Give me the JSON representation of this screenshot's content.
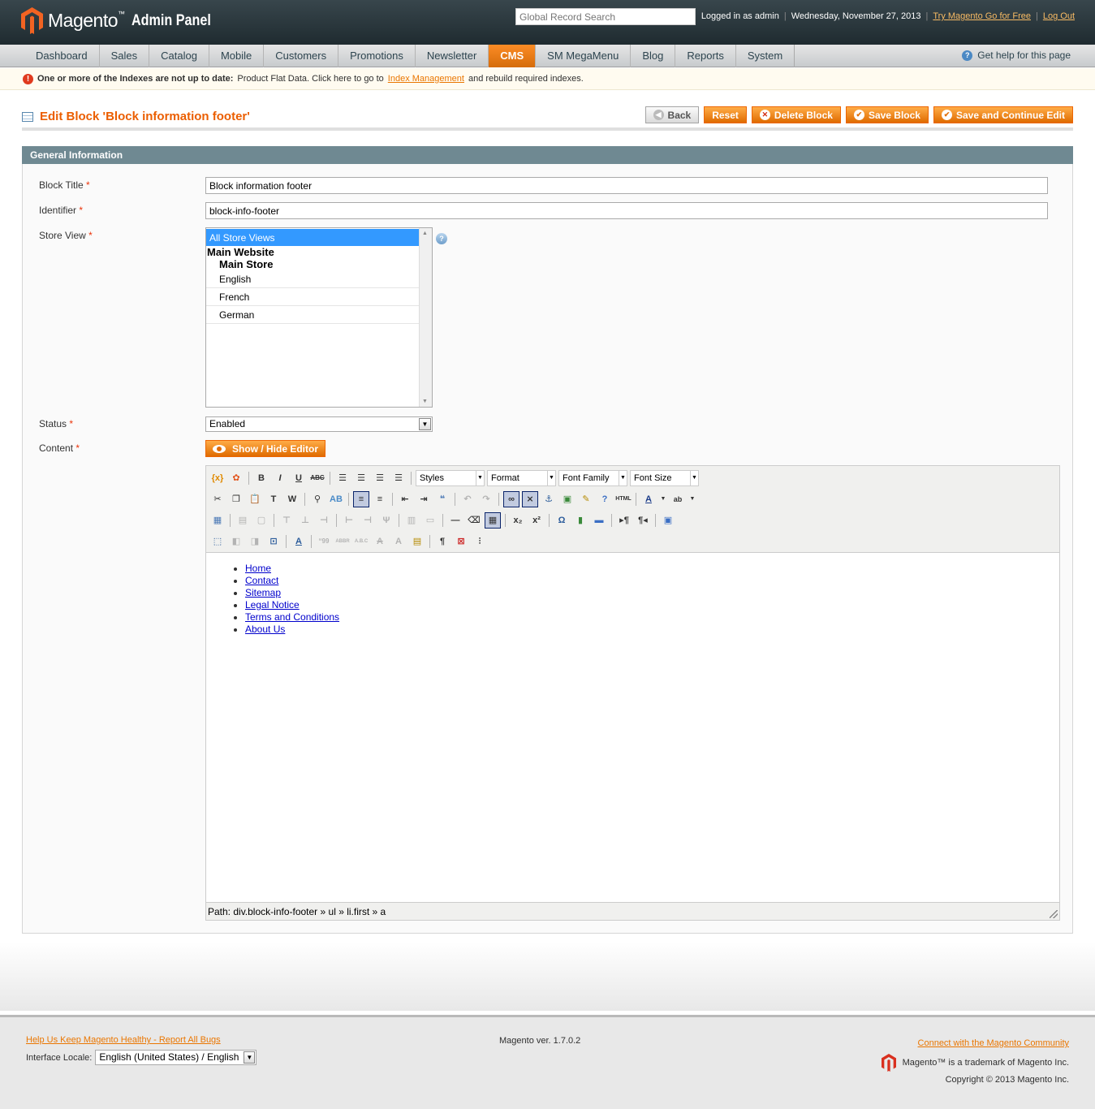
{
  "header": {
    "logo_text": "Magento",
    "logo_tm": "™",
    "logo_sub": "Admin Panel",
    "search_placeholder": "Global Record Search",
    "logged_in": "Logged in as admin",
    "date": "Wednesday, November 27, 2013",
    "try_link": "Try Magento Go for Free",
    "logout": "Log Out"
  },
  "nav": {
    "items": [
      "Dashboard",
      "Sales",
      "Catalog",
      "Mobile",
      "Customers",
      "Promotions",
      "Newsletter",
      "CMS",
      "SM MegaMenu",
      "Blog",
      "Reports",
      "System"
    ],
    "active": "CMS",
    "help": "Get help for this page"
  },
  "message": {
    "bold": "One or more of the Indexes are not up to date:",
    "text": "Product Flat Data. Click here to go to",
    "link": "Index Management",
    "tail": "and rebuild required indexes."
  },
  "page": {
    "title": "Edit Block 'Block information footer'",
    "buttons": {
      "back": "Back",
      "reset": "Reset",
      "delete": "Delete Block",
      "save": "Save Block",
      "save_continue": "Save and Continue Edit"
    }
  },
  "form": {
    "section": "General Information",
    "block_title_label": "Block Title",
    "block_title_value": "Block information footer",
    "identifier_label": "Identifier",
    "identifier_value": "block-info-footer",
    "store_view_label": "Store View",
    "store_options": {
      "all": "All Store Views",
      "website": "Main Website",
      "store": "Main Store",
      "views": [
        "English",
        "French",
        "German"
      ]
    },
    "status_label": "Status",
    "status_value": "Enabled",
    "content_label": "Content",
    "show_hide": "Show / Hide Editor",
    "required_mark": "*"
  },
  "editor": {
    "styles": "Styles",
    "format": "Format",
    "font_family": "Font Family",
    "font_size": "Font Size",
    "links": [
      "Home",
      "Contact",
      "Sitemap",
      "Legal Notice",
      "Terms and Conditions",
      "About Us"
    ],
    "path": "Path: div.block-info-footer » ul » li.first » a"
  },
  "footer": {
    "report_bugs": "Help Us Keep Magento Healthy - Report All Bugs",
    "locale_label": "Interface Locale:",
    "locale_value": "English (United States) / English",
    "version": "Magento ver. 1.7.0.2",
    "community": "Connect with the Magento Community",
    "trademark": "Magento™ is a trademark of Magento Inc.",
    "copyright": "Copyright © 2013 Magento Inc."
  },
  "colors": {
    "accent": "#eb5e00",
    "header_bg": "#2b393f",
    "section_head": "#6f8992"
  }
}
